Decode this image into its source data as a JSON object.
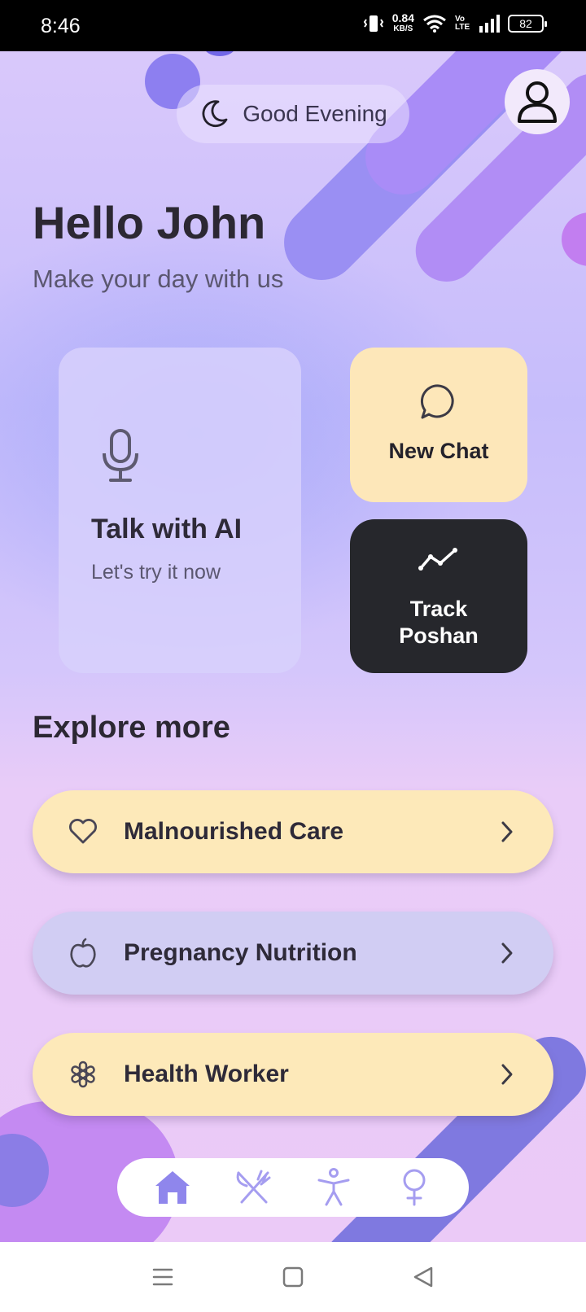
{
  "status_bar": {
    "time": "8:46",
    "net_speed": "0.84",
    "net_unit": "KB/S",
    "volte": "Vo LTE",
    "battery": "82"
  },
  "header": {
    "greeting": "Good Evening",
    "moon_icon": "moon-icon",
    "profile_icon": "user-icon"
  },
  "hero": {
    "title": "Hello John",
    "subtitle": "Make your day with us"
  },
  "cards": {
    "talk": {
      "title": "Talk with AI",
      "subtitle": "Let's try it now",
      "icon": "microphone-icon"
    },
    "new_chat": {
      "label": "New Chat",
      "icon": "chat-bubble-icon"
    },
    "track": {
      "line1": "Track",
      "line2": "Poshan",
      "icon": "trend-line-icon"
    }
  },
  "explore": {
    "title": "Explore more",
    "items": [
      {
        "label": "Malnourished Care",
        "icon": "heart-icon",
        "color": "#fde9b9"
      },
      {
        "label": "Pregnancy Nutrition",
        "icon": "apple-icon",
        "color": "#d1cdf3"
      },
      {
        "label": "Health Worker",
        "icon": "asterisk-icon",
        "color": "#fde9b9"
      }
    ]
  },
  "tabbar": {
    "tabs": [
      {
        "icon": "home-icon",
        "active": true
      },
      {
        "icon": "fork-knife-icon",
        "active": false
      },
      {
        "icon": "person-icon",
        "active": false
      },
      {
        "icon": "female-icon",
        "active": false
      }
    ]
  },
  "colors": {
    "accent": "#8f86ec",
    "card_yellow": "#fde7b9",
    "card_dark": "#26272c"
  }
}
